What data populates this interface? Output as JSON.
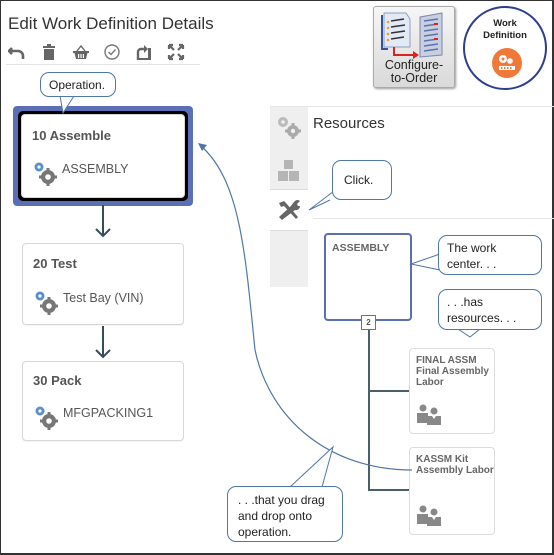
{
  "page": {
    "title": "Edit Work Definition Details"
  },
  "toolbar": {
    "icons": [
      {
        "name": "undo-icon",
        "label": "Undo"
      },
      {
        "name": "delete-icon",
        "label": "Delete"
      },
      {
        "name": "basket-icon",
        "label": "Items"
      },
      {
        "name": "check-circle-icon",
        "label": "Validate"
      },
      {
        "name": "rotate-layout-icon",
        "label": "Change Layout"
      },
      {
        "name": "expand-icon",
        "label": "Expand"
      }
    ]
  },
  "operations": [
    {
      "title": "10 Assemble",
      "work_center": "ASSEMBLY",
      "selected": true
    },
    {
      "title": "20 Test",
      "work_center": "Test Bay (VIN)",
      "selected": false
    },
    {
      "title": "30 Pack",
      "work_center": "MFGPACKING1",
      "selected": false
    }
  ],
  "logos": {
    "configure_to_order": {
      "line1": "Configure-",
      "line2": "to-Order"
    },
    "work_definition": {
      "line1": "Work",
      "line2": "Definition"
    }
  },
  "resources_panel": {
    "title": "Resources",
    "tabs": [
      {
        "name": "work-centers-tab",
        "icon": "gears-icon",
        "active": false
      },
      {
        "name": "items-tab",
        "icon": "blocks-icon",
        "active": false
      },
      {
        "name": "resources-tab",
        "icon": "tools-icon",
        "active": true
      }
    ],
    "work_center": {
      "title": "ASSEMBLY",
      "resource_count": "2"
    },
    "resources": [
      {
        "code": "FINAL ASSM",
        "name": "Final Assembly Labor"
      },
      {
        "code": "KASSM Kit",
        "name": "Assembly Labor"
      }
    ]
  },
  "callouts": {
    "operation": "Operation.",
    "click": "Click.",
    "work_center": "The work center. . .",
    "has_resources": ". . .has resources. . .",
    "drag_drop": ". . .that you drag and drop onto operation."
  },
  "colors": {
    "accent": "#5a6fb5",
    "callout_border": "#4f77a8",
    "badge_orange": "#f0793a"
  }
}
